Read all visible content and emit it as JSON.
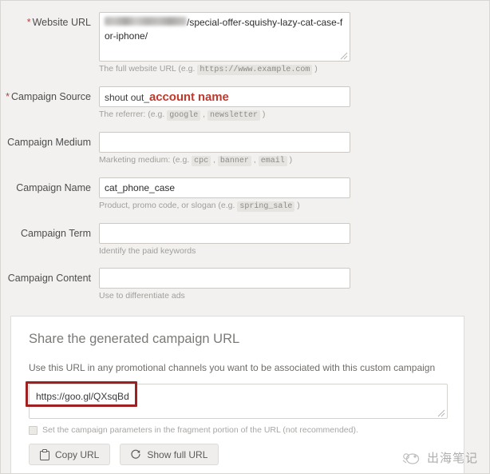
{
  "colors": {
    "page_bg": "#f2f1ef",
    "panel_bg": "#ffffff",
    "accent_red": "#c0392b",
    "highlight_red": "#9e2020",
    "required_star": "#b0453f",
    "hint_text": "#a09e9b"
  },
  "form": {
    "fields": [
      {
        "label": "Website URL",
        "required": true,
        "star": "*",
        "type": "textarea",
        "value_redacted": true,
        "value_visible": "/special-offer-squishy-lazy-cat-case-for-iphone/",
        "hint_before": "The full website URL (e.g. ",
        "hint_code": "https://www.example.com",
        "hint_after": " )"
      },
      {
        "label": "Campaign Source",
        "required": true,
        "star": "*",
        "type": "input",
        "value_plain": "shout out_",
        "value_emphasis": "account name",
        "hint_before": "The referrer: (e.g. ",
        "hint_code": "google",
        "hint_sep": " , ",
        "hint_code2": "newsletter",
        "hint_after": " )"
      },
      {
        "label": "Campaign Medium",
        "required": false,
        "star": "",
        "type": "input",
        "value": "",
        "hint_before": "Marketing medium: (e.g. ",
        "hint_code": "cpc",
        "hint_sep": " , ",
        "hint_code2": "banner",
        "hint_sep2": " , ",
        "hint_code3": "email",
        "hint_after": " )"
      },
      {
        "label": "Campaign Name",
        "required": false,
        "star": "",
        "type": "input",
        "value": "cat_phone_case",
        "hint_before": "Product, promo code, or slogan (e.g. ",
        "hint_code": "spring_sale",
        "hint_after": " )"
      },
      {
        "label": "Campaign Term",
        "required": false,
        "star": "",
        "type": "input",
        "value": "",
        "hint_before": "Identify the paid keywords",
        "hint_code": "",
        "hint_after": ""
      },
      {
        "label": "Campaign Content",
        "required": false,
        "star": "",
        "type": "input",
        "value": "",
        "hint_before": "Use to differentiate ads",
        "hint_code": "",
        "hint_after": ""
      }
    ]
  },
  "share": {
    "title": "Share the generated campaign URL",
    "subtitle": "Use this URL in any promotional channels you want to be associated with this custom campaign",
    "generated_url": "https://goo.gl/QXsqBd",
    "checkbox_label": "Set the campaign parameters in the fragment portion of the URL (not recommended).",
    "checkbox_checked": false,
    "buttons": [
      {
        "label": "Copy URL",
        "icon": "clipboard-icon"
      },
      {
        "label": "Show full URL",
        "icon": "refresh-icon"
      }
    ]
  },
  "watermark": {
    "text": "出海笔记",
    "icon": "cloud-logo-icon"
  }
}
